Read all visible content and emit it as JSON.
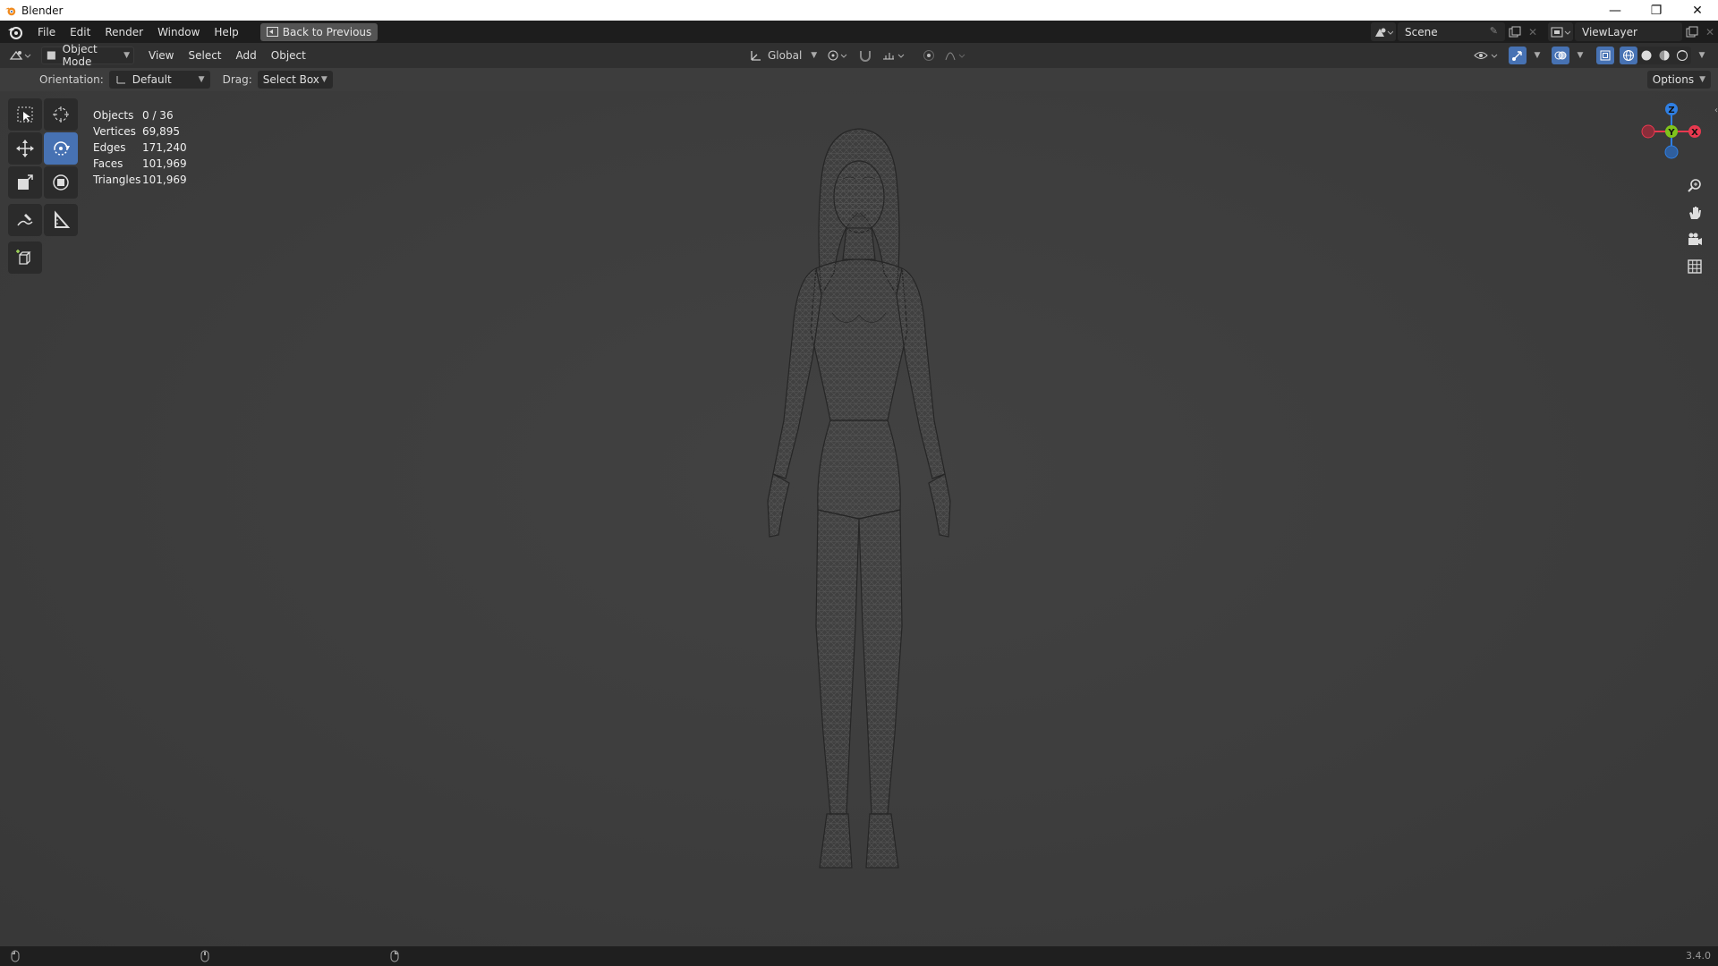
{
  "window": {
    "title": "Blender",
    "controls": [
      "—",
      "❐",
      "✕"
    ]
  },
  "topbar": {
    "menus": [
      "File",
      "Edit",
      "Render",
      "Window",
      "Help"
    ],
    "back_button": "Back to Previous",
    "scene": "Scene",
    "view_layer": "ViewLayer"
  },
  "viewport_header": {
    "mode": "Object Mode",
    "menus": [
      "View",
      "Select",
      "Add",
      "Object"
    ],
    "transform_orientation": "Global"
  },
  "tool_settings": {
    "orientation_label": "Orientation:",
    "orientation_value": "Default",
    "drag_label": "Drag:",
    "drag_value": "Select Box",
    "options": "Options"
  },
  "stats": [
    {
      "key": "Objects",
      "value": "0 / 36"
    },
    {
      "key": "Vertices",
      "value": "69,895"
    },
    {
      "key": "Edges",
      "value": "171,240"
    },
    {
      "key": "Faces",
      "value": "101,969"
    },
    {
      "key": "Triangles",
      "value": "101,969"
    }
  ],
  "gizmo": {
    "z": "Z",
    "y": "Y",
    "x": "X"
  },
  "statusbar": {
    "version": "3.4.0"
  },
  "colors": {
    "accent": "#4772b3",
    "x_axis": "#e8394f",
    "y_axis": "#7fc31c",
    "z_axis": "#2f7fe3"
  }
}
